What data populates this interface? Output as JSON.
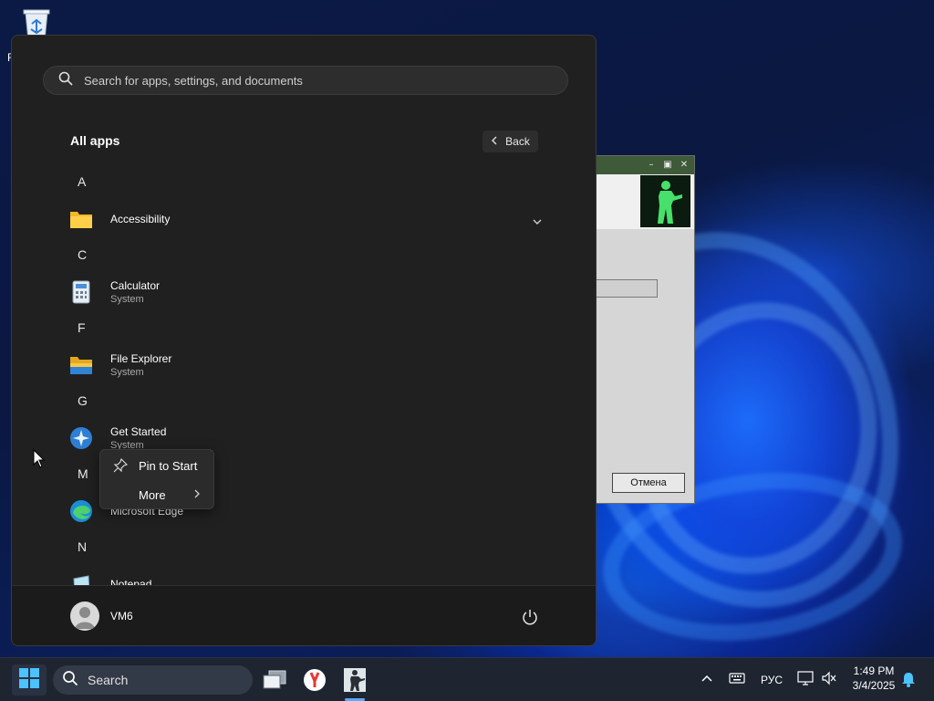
{
  "desktop": {
    "recycle_bin_label": "R",
    "wallpaper": "windows-11-bloom-blue"
  },
  "background_window": {
    "cancel_label": "Отмена",
    "image": "counter-strike-soldier-icon"
  },
  "start_menu": {
    "search_placeholder": "Search for apps, settings, and documents",
    "all_apps_title": "All apps",
    "back_label": "Back",
    "sections": [
      {
        "letter": "A",
        "apps": [
          {
            "name": "Accessibility",
            "sub": "",
            "icon": "folder-icon",
            "expandable": true
          }
        ]
      },
      {
        "letter": "C",
        "apps": [
          {
            "name": "Calculator",
            "sub": "System",
            "icon": "calculator-icon"
          }
        ]
      },
      {
        "letter": "F",
        "apps": [
          {
            "name": "File Explorer",
            "sub": "System",
            "icon": "file-explorer-icon"
          }
        ]
      },
      {
        "letter": "G",
        "apps": [
          {
            "name": "Get Started",
            "sub": "System",
            "icon": "get-started-icon"
          }
        ]
      },
      {
        "letter": "M",
        "apps": [
          {
            "name": "Microsoft Edge",
            "sub": "",
            "icon": "edge-icon"
          }
        ]
      },
      {
        "letter": "N",
        "apps": [
          {
            "name": "Notepad",
            "sub": "",
            "icon": "notepad-icon"
          }
        ]
      }
    ],
    "user_name": "VM6"
  },
  "context_menu": {
    "items": [
      {
        "label": "Pin to Start",
        "icon": "pin-icon"
      },
      {
        "label": "More",
        "icon": "chevron-right-icon"
      }
    ]
  },
  "taskbar": {
    "search_placeholder": "Search",
    "pinned": [
      "task-view-icon",
      "yandex-browser-icon",
      "counter-strike-icon"
    ],
    "language": "РУС",
    "time": "1:49 PM",
    "date": "3/4/2025"
  },
  "colors": {
    "accent": "#5aa8ff",
    "start_bg": "#202020",
    "taskbar_bg": "#1e2430"
  }
}
